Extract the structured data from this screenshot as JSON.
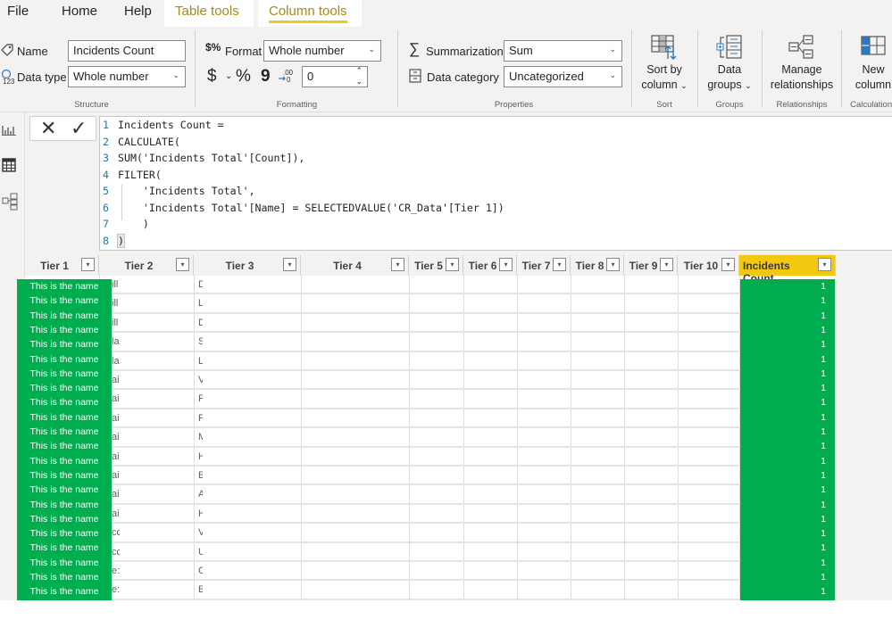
{
  "ribbon_tabs": [
    {
      "label": "File",
      "contextual": false,
      "active": false
    },
    {
      "label": "Home",
      "contextual": false,
      "active": false
    },
    {
      "label": "Help",
      "contextual": false,
      "active": false
    },
    {
      "label": "Table tools",
      "contextual": true,
      "active": false
    },
    {
      "label": "Column tools",
      "contextual": true,
      "active": true
    }
  ],
  "structure": {
    "group_label": "Structure",
    "name_label": "Name",
    "name_value": "Incidents Count",
    "datatype_label": "Data type",
    "datatype_value": "Whole number"
  },
  "formatting": {
    "group_label": "Formatting",
    "format_label": "Format",
    "format_value": "Whole number",
    "currency_symbol": "$",
    "percent_symbol": "%",
    "comma_symbol": "9",
    "decimals_value": "0"
  },
  "properties": {
    "group_label": "Properties",
    "summarization_label": "Summarization",
    "summarization_value": "Sum",
    "datacategory_label": "Data category",
    "datacategory_value": "Uncategorized"
  },
  "sort": {
    "group_label": "Sort",
    "button_line1": "Sort by",
    "button_line2": "column"
  },
  "groups": {
    "group_label": "Groups",
    "button_line1": "Data",
    "button_line2": "groups"
  },
  "relationships": {
    "group_label": "Relationships",
    "button_line1": "Manage",
    "button_line2": "relationships"
  },
  "calculations": {
    "group_label": "Calculations",
    "button_line1": "New",
    "button_line2": "column"
  },
  "left_rail": [
    "report-view-icon",
    "data-view-icon",
    "model-view-icon"
  ],
  "formula_bar": {
    "cancel_glyph": "✕",
    "commit_glyph": "✓",
    "lines": [
      {
        "n": "1",
        "text": "Incidents Count ="
      },
      {
        "n": "2",
        "text": "CALCULATE("
      },
      {
        "n": "3",
        "text": "SUM('Incidents Total'[Count]),"
      },
      {
        "n": "4",
        "text": "FILTER("
      },
      {
        "n": "5",
        "text": "    'Incidents Total',"
      },
      {
        "n": "6",
        "text": "    'Incidents Total'[Name] = SELECTEDVALUE('CR_Data'[Tier 1])"
      },
      {
        "n": "7",
        "text": "    )"
      },
      {
        "n": "8",
        "text": ")"
      }
    ]
  },
  "table": {
    "columns": [
      "Tier 1",
      "Tier 2",
      "Tier 3",
      "Tier 4",
      "Tier 5",
      "Tier 6",
      "Tier 7",
      "Tier 8",
      "Tier 9",
      "Tier 10",
      "Incidents Count"
    ],
    "selected_column": "Incidents Count",
    "tier2_fragments": [
      "ill",
      "ill",
      "ill",
      "la",
      "la",
      "ai",
      "ai",
      "ai",
      "ai",
      "ai",
      "ai",
      "ai",
      "ai",
      "cc",
      "cc",
      "e:",
      "e:"
    ],
    "tier3_fragments": [
      "D",
      "L",
      "D",
      "S",
      "L",
      "V",
      "F",
      "F",
      "M",
      "H",
      "E",
      "A",
      "H",
      "V",
      "U",
      "C",
      "E"
    ]
  },
  "overlay_left": {
    "color": "#00ad4e",
    "names": [
      "This is the name",
      "This is the name",
      "This is the name",
      "This is the name",
      "This is the name",
      "This is the name",
      "This is the name",
      "This is the name",
      "This is the name",
      "This is the name",
      "This is the name",
      "This is the name",
      "This is the name",
      "This is the name",
      "This is the name",
      "This is the name",
      "This is the name",
      "This is the name",
      "This is the name",
      "This is the name",
      "This is the name",
      "This is the name"
    ]
  },
  "overlay_right": {
    "color": "#00ad4e",
    "values": [
      "1",
      "1",
      "1",
      "1",
      "1",
      "1",
      "1",
      "1",
      "1",
      "1",
      "1",
      "1",
      "1",
      "1",
      "1",
      "1",
      "1",
      "1",
      "1",
      "1",
      "1",
      "1"
    ]
  },
  "colors": {
    "accent_yellow": "#f2c811",
    "contextual_tab_text": "#a98a18",
    "keyword_blue": "#3165bb"
  }
}
